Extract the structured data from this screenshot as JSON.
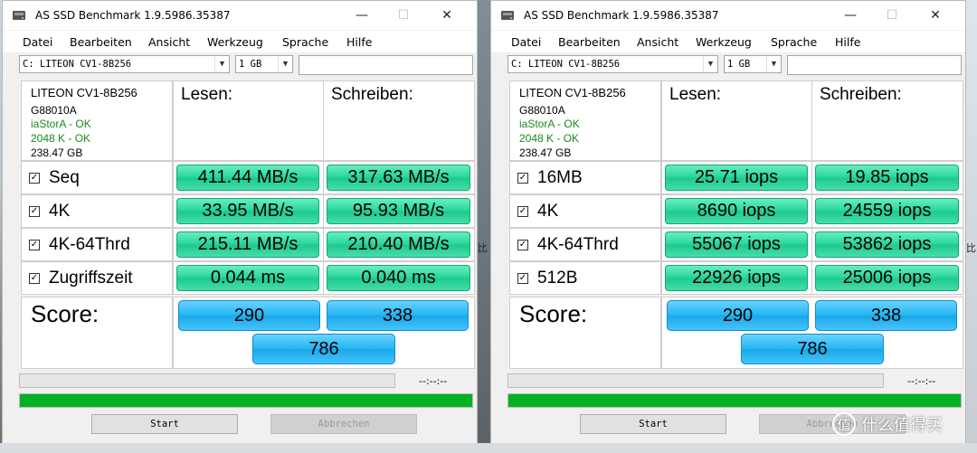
{
  "windows": [
    {
      "title": "AS SSD Benchmark 1.9.5986.35387",
      "menu": [
        "Datei",
        "Bearbeiten",
        "Ansicht",
        "Werkzeug",
        "Sprache",
        "Hilfe"
      ],
      "drive_select": "C:  LITEON CV1-8B256",
      "size_select": "1 GB",
      "drive_name": "LITEON CV1-8B256",
      "firmware": "G88010A",
      "driver_status": "iaStorA - OK",
      "align_status": "2048 K - OK",
      "capacity": "238.47 GB",
      "col_read": "Lesen:",
      "col_write": "Schreiben:",
      "rows": [
        {
          "label": "Seq",
          "read": "411.44 MB/s",
          "write": "317.63 MB/s"
        },
        {
          "label": "4K",
          "read": "33.95 MB/s",
          "write": "95.93 MB/s"
        },
        {
          "label": "4K-64Thrd",
          "read": "215.11 MB/s",
          "write": "210.40 MB/s"
        },
        {
          "label": "Zugriffszeit",
          "read": "0.044 ms",
          "write": "0.040 ms"
        }
      ],
      "score_label": "Score:",
      "score_read": "290",
      "score_write": "338",
      "score_total": "786",
      "timer": "--:--:--",
      "start_label": "Start",
      "abort_label": "Abbrechen"
    },
    {
      "title": "AS SSD Benchmark 1.9.5986.35387",
      "menu": [
        "Datei",
        "Bearbeiten",
        "Ansicht",
        "Werkzeug",
        "Sprache",
        "Hilfe"
      ],
      "drive_select": "C:  LITEON CV1-8B256",
      "size_select": "1 GB",
      "drive_name": "LITEON CV1-8B256",
      "firmware": "G88010A",
      "driver_status": "iaStorA - OK",
      "align_status": "2048 K - OK",
      "capacity": "238.47 GB",
      "col_read": "Lesen:",
      "col_write": "Schreiben:",
      "rows": [
        {
          "label": "16MB",
          "read": "25.71 iops",
          "write": "19.85 iops"
        },
        {
          "label": "4K",
          "read": "8690 iops",
          "write": "24559 iops"
        },
        {
          "label": "4K-64Thrd",
          "read": "55067 iops",
          "write": "53862 iops"
        },
        {
          "label": "512B",
          "read": "22926 iops",
          "write": "25006 iops"
        }
      ],
      "score_label": "Score:",
      "score_read": "290",
      "score_write": "338",
      "score_total": "786",
      "timer": "--:--:--",
      "start_label": "Start",
      "abort_label": "Abbrechen"
    }
  ],
  "colors": {
    "ok_text": "#1a8a1a",
    "result_green": "#28d59a",
    "score_blue": "#25b6f2",
    "progress_green": "#06b025"
  },
  "watermark": {
    "symbol": "值",
    "text": "什么值得买"
  },
  "bg_text": "比"
}
